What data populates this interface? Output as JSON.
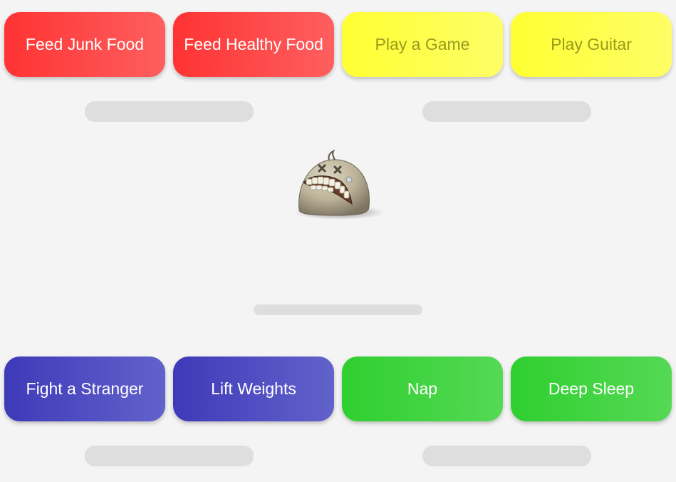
{
  "buttons": {
    "feed_junk_food": "Feed Junk Food",
    "feed_healthy_food": "Feed Healthy Food",
    "play_a_game": "Play a Game",
    "play_guitar": "Play Guitar",
    "fight_a_stranger": "Fight a Stranger",
    "lift_weights": "Lift Weights",
    "nap": "Nap",
    "deep_sleep": "Deep Sleep"
  },
  "stat_bars": {
    "hunger": 0,
    "fun": 0,
    "age": 0,
    "strength": 0,
    "energy": 0
  },
  "pet": {
    "state": "dead",
    "icon": "dead-blob-pet-icon"
  },
  "colors": {
    "food": "#ff3333",
    "play": "#ffff33",
    "strength": "#3e3ab8",
    "sleep": "#2fcf2f",
    "background": "#f4f4f4",
    "bar_track": "#dedede"
  }
}
